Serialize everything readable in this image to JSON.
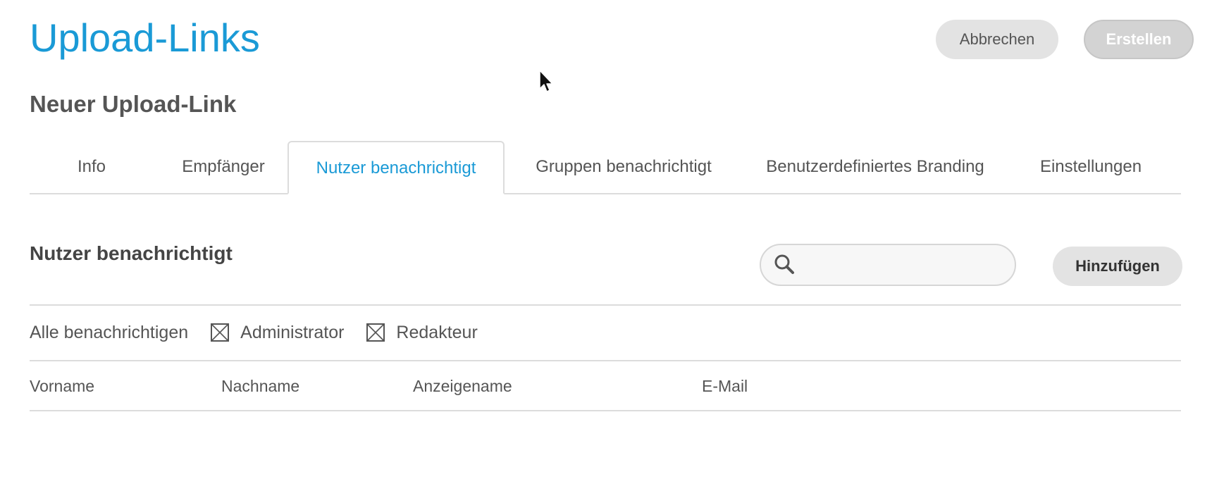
{
  "header": {
    "title": "Upload-Links",
    "cancel_label": "Abbrechen",
    "create_label": "Erstellen"
  },
  "form": {
    "subtitle": "Neuer Upload-Link"
  },
  "tabs": [
    {
      "label": "Info",
      "active": false
    },
    {
      "label": "Empfänger",
      "active": false
    },
    {
      "label": "Nutzer benachrichtigt",
      "active": true
    },
    {
      "label": "Gruppen benachrichtigt",
      "active": false
    },
    {
      "label": "Benutzerdefiniertes Branding",
      "active": false
    },
    {
      "label": "Einstellungen",
      "active": false
    }
  ],
  "section": {
    "title": "Nutzer benachrichtigt",
    "search": {
      "value": "",
      "placeholder": "",
      "icon": "search-icon"
    },
    "add_label": "Hinzufügen"
  },
  "notify": {
    "label": "Alle benachrichtigen",
    "options": [
      {
        "label": "Administrator",
        "checked": false
      },
      {
        "label": "Redakteur",
        "checked": false
      }
    ]
  },
  "table": {
    "columns": [
      "Vorname",
      "Nachname",
      "Anzeigename",
      "E-Mail"
    ],
    "rows": []
  },
  "colors": {
    "accent": "#1a9ad6",
    "button_bg": "#e3e3e3",
    "divider": "#dcdcdc"
  }
}
